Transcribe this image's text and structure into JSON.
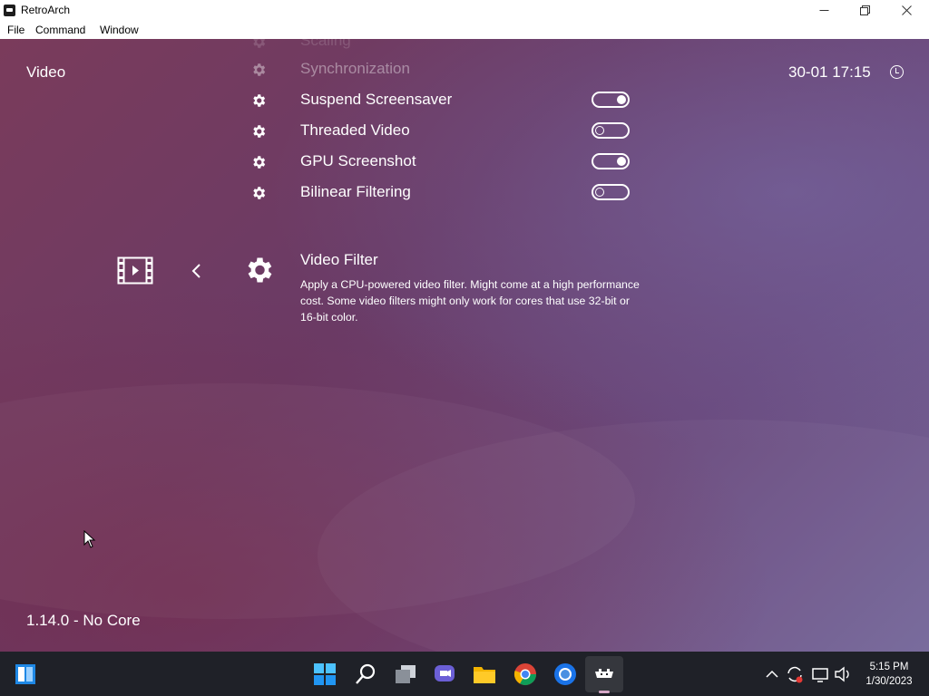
{
  "window": {
    "title": "RetroArch",
    "menu": [
      "File",
      "Command",
      "Window"
    ]
  },
  "header": {
    "section": "Video",
    "clock": "30-01 17:15"
  },
  "menu_items": [
    {
      "label": "Scaling",
      "toggle": null
    },
    {
      "label": "Synchronization",
      "toggle": null
    },
    {
      "label": "Suspend Screensaver",
      "toggle": "on"
    },
    {
      "label": "Threaded Video",
      "toggle": "off"
    },
    {
      "label": "GPU Screenshot",
      "toggle": "on"
    },
    {
      "label": "Bilinear Filtering",
      "toggle": "off"
    }
  ],
  "selected": {
    "title": "Video Filter",
    "description": "Apply a CPU-powered video filter. Might come at a high performance cost. Some video filters might only work for cores that use 32-bit or 16-bit color."
  },
  "footer": {
    "version": "1.14.0 - No Core"
  },
  "taskbar": {
    "icons": [
      "start-icon",
      "search-icon",
      "task-view-icon",
      "chat-icon",
      "file-explorer-icon",
      "chrome-icon",
      "chrome-alt-icon",
      "retroarch-icon"
    ],
    "time": "5:15 PM",
    "date": "1/30/2023"
  },
  "colors": {
    "accent_text": "#ffffff",
    "taskbar": "#1f2128"
  }
}
